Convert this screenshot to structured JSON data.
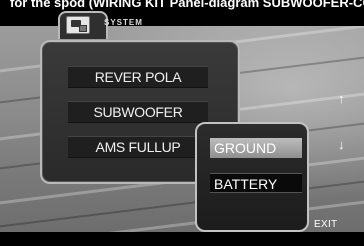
{
  "caption_text": "for the spod (WIRING KIT Panel-diagram SUBWOOFER-CONTROLLER)",
  "panel": {
    "title": "SYSTEM",
    "icon": "system-icon"
  },
  "menu": {
    "items": [
      {
        "label": "REVER POLA"
      },
      {
        "label": "SUBWOOFER"
      },
      {
        "label": "AMS FULLUP"
      }
    ]
  },
  "popup": {
    "options": [
      {
        "label": "GROUND",
        "selected": true
      },
      {
        "label": "BATTERY",
        "selected": false
      }
    ]
  },
  "nav": {
    "up": "↑",
    "down": "↓",
    "exit": "EXIT"
  },
  "colors": {
    "screen": "#8a8a8a",
    "panel": "#2a2a2a",
    "highlight": "#bdbdbd"
  }
}
